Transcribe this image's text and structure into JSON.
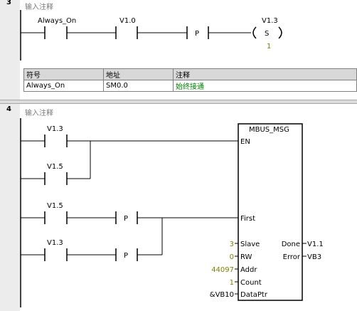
{
  "network3": {
    "number": "3",
    "comment": "输入注释",
    "contact_symbol": "Always_On",
    "contact_address": "V1.0",
    "edge_label": "P",
    "coil_address": "V1.3",
    "coil_label": "S",
    "coil_count": "1",
    "symbol_table": {
      "headers": [
        "符号",
        "地址",
        "注释"
      ],
      "rows": [
        [
          "Always_On",
          "SM0.0",
          "始终接通"
        ]
      ]
    }
  },
  "network4": {
    "number": "4",
    "comment": "输入注释",
    "contacts": [
      "V1.3",
      "V1.5",
      "V1.5",
      "V1.3"
    ],
    "edge_label": "P",
    "block": {
      "title": "MBUS_MSG",
      "en": "EN",
      "first": "First",
      "inputs": [
        {
          "label": "Slave",
          "value": "3"
        },
        {
          "label": "RW",
          "value": "0"
        },
        {
          "label": "Addr",
          "value": "44097"
        },
        {
          "label": "Count",
          "value": "1"
        },
        {
          "label": "DataPtr",
          "value": "&VB10"
        }
      ],
      "outputs": [
        {
          "label": "Done",
          "value": "V1.1"
        },
        {
          "label": "Error",
          "value": "VB3"
        }
      ]
    }
  },
  "colors": {
    "wire": "#000000",
    "constant": "#808000",
    "comment": "#008000",
    "gutter": "#ececec"
  }
}
